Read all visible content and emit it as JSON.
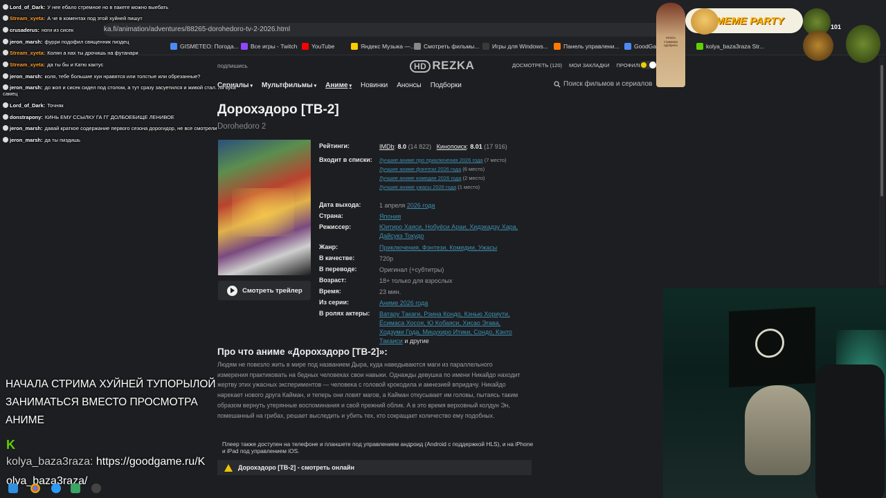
{
  "browser": {
    "url_fragment": "ka.fi/animation/adventures/88265-dorohedoro-tv-2-2026.html",
    "bookmarks": [
      {
        "label": "GISMETEO: Погода...",
        "color": "#4c8bf5"
      },
      {
        "label": "Все игры - Twitch",
        "color": "#9146ff"
      },
      {
        "label": "YouTube",
        "color": "#ff0000"
      },
      {
        "label": "Яндекс Музыка —...",
        "color": "#ffcc00"
      },
      {
        "label": "Смотреть фильмы...",
        "color": "#888888"
      },
      {
        "label": "Игры для Windows...",
        "color": "#3a3a3a"
      },
      {
        "label": "Панель управлени...",
        "color": "#ff7a00"
      },
      {
        "label": "GoodGan",
        "color": "#4c8bf5"
      },
      {
        "label": "kolya_baza3raza Str...",
        "color": "#5fd100"
      }
    ]
  },
  "site": {
    "subscribe": "подпишись",
    "logo_hd": "HD",
    "logo_text": "REZKA",
    "top_links": [
      "ДОСМОТРЕТЬ (120)",
      "МОИ ЗАКЛАДКИ",
      "ПРОФИЛЬ"
    ],
    "nav": [
      {
        "label": "Сериалы",
        "caret": "▾",
        "active": false
      },
      {
        "label": "Мультфильмы",
        "caret": "▾",
        "active": false
      },
      {
        "label": "Аниме",
        "caret": "▾",
        "active": true
      },
      {
        "label": "Новинки",
        "caret": "",
        "active": false
      },
      {
        "label": "Анонсы",
        "caret": "",
        "active": false
      },
      {
        "label": "Подборки",
        "caret": "",
        "active": false
      }
    ],
    "search_placeholder": "Поиск фильмов и сериалов"
  },
  "movie": {
    "title": "Дорохэдоро [ТВ-2]",
    "orig_title": "Dorohedoro 2",
    "trailer_label": "Смотреть трейлер",
    "ratings_label": "Рейтинги:",
    "imdb_label": "IMDb",
    "imdb_score": "8.0",
    "imdb_votes": "(14 822)",
    "kp_label": "Кинопоиск",
    "kp_score": "8.01",
    "kp_votes": "(17 916)",
    "lists_label": "Входит в списки:",
    "lists": [
      {
        "name": "Лучшие аниме про приключения 2026 года",
        "place": "(7 место)"
      },
      {
        "name": "Лучшие аниме фэнтези 2026 года",
        "place": "(6 место)"
      },
      {
        "name": "Лучшие аниме комедии 2026 года",
        "place": "(2 место)"
      },
      {
        "name": "Лучшие аниме ужасы 2026 года",
        "place": "(1 место)"
      }
    ],
    "release_label": "Дата выхода:",
    "release_day": "1 апреля",
    "release_year": "2026 года",
    "country_label": "Страна:",
    "country": "Япония",
    "director_label": "Режиссер:",
    "directors": "Юитиро Хаяси, Нобуёси Араи, Хидэкадзу Хара, Дайсукэ Токудо",
    "genre_label": "Жанр:",
    "genres": "Приключения, Фэнтези, Комедии, Ужасы",
    "quality_label": "В качестве:",
    "quality": "720p",
    "translation_label": "В переводе:",
    "translation": "Оригинал (+субтитры)",
    "age_label": "Возраст:",
    "age": "18+ только для взрослых",
    "duration_label": "Время:",
    "duration": "23 мин.",
    "series_label": "Из серии:",
    "series": "Аниме 2026 года",
    "cast_label": "В ролях актеры:",
    "cast": "Ватару Такаги, Рэина Кондо, Кэнью Хориути, Ёсимаса Хосоя, Ю Кобаяси, Хисао Эгава, Ходзуми Года, Мицухиро Итики, Сондо, Кэнто Такаиси",
    "cast_suffix": "и другие",
    "about_title": "Про что аниме «Дорохэдоро [ТВ-2]»:",
    "about_text": "Людям не повезло жить в мире под названием Дыра, куда наведываются маги из параллельного измерения практиковать на бедных человеках свои навыки. Однажды девушка по имени Никайдо находит жертву этих ужасных экспериментов — человека с головой крокодила и амнезией впридачу. Никайдо нарекает нового друга Кайман, и теперь они ловят магов, а Кайман откусывает им головы, пытаясь таким образом вернуть утерянные воспоминания и свой прежний облик. А в это время верховный колдун Эн, помешанный на грибах, решает выследить и убить тех, кто сокращает количество ему подобных.",
    "player_note": "Плеер также доступен на телефоне и планшете под управлением андроид (Android с поддержкой HLS), и на iPhone и iPad под управлением iOS.",
    "watch_label": "Дорохэдоро [ТВ-2] - смотреть онлайн"
  },
  "chat": [
    {
      "user": "Lord_of_Dark:",
      "color": "#ffffff",
      "text": "У нее ебало стремное но в пакете можно выебать"
    },
    {
      "user": "Stream_xyeta:",
      "color": "#ff9d2e",
      "text": "А че в коментах под этой хуйней пишут"
    },
    {
      "user": "crusaderus:",
      "color": "#ffffff",
      "text": "ноги из сисек"
    },
    {
      "user": "jeron_marsh:",
      "color": "#ffffff",
      "text": "фурри подофил священник пиздец"
    },
    {
      "user": "Stream_xyeta:",
      "color": "#ff9d2e",
      "text": "Колян а нах ты дрочишь на футанари"
    },
    {
      "user": "Stream_xyeta:",
      "color": "#ff9d2e",
      "text": "да ты бы и Катю кактус"
    },
    {
      "user": "jeron_marsh:",
      "color": "#ffffff",
      "text": "коля, тебе большие хуи нравятся или толстые или обрезанные?"
    },
    {
      "user": "jeron_marsh:",
      "color": "#ffffff",
      "text": "до жоп и сисек сидел под столом, а тут сразу засуетился и живой стал. ля сука"
    },
    {
      "user": "",
      "color": "#ffffff",
      "text": "самец"
    },
    {
      "user": "Lord_of_Dark:",
      "color": "#ffffff",
      "text": "Точняк"
    },
    {
      "user": "donstrapony:",
      "color": "#ffffff",
      "text": "КИНЬ ЕМУ ССЫЛКУ ГА ГГ ДОЛБОЕБИЩЕ ЛЕНИВОЕ"
    },
    {
      "user": "jeron_marsh:",
      "color": "#ffffff",
      "text": "давай краткое содержание первого сезона дорогидор, не все смотрели"
    },
    {
      "user": "jeron_marsh:",
      "color": "#ffffff",
      "text": "да ты пиздишь"
    }
  ],
  "stream": {
    "message": "НАЧАЛА СТРИМА ХУЙНЕЙ ТУПОРЫЛОЙ ЗАНИМАТЬСЯ ВМЕСТО ПРОСМОТРА АНИМЕ",
    "k_logo": "K",
    "link_user": "kolya_baza3raza:",
    "link_url": "https://goodgame.ru/K",
    "link_line2": "olya_baza3raza/"
  },
  "overlay": {
    "meme_party": "MEME PARTY",
    "count": "101",
    "seal_text": "печать стримера одобрено"
  }
}
